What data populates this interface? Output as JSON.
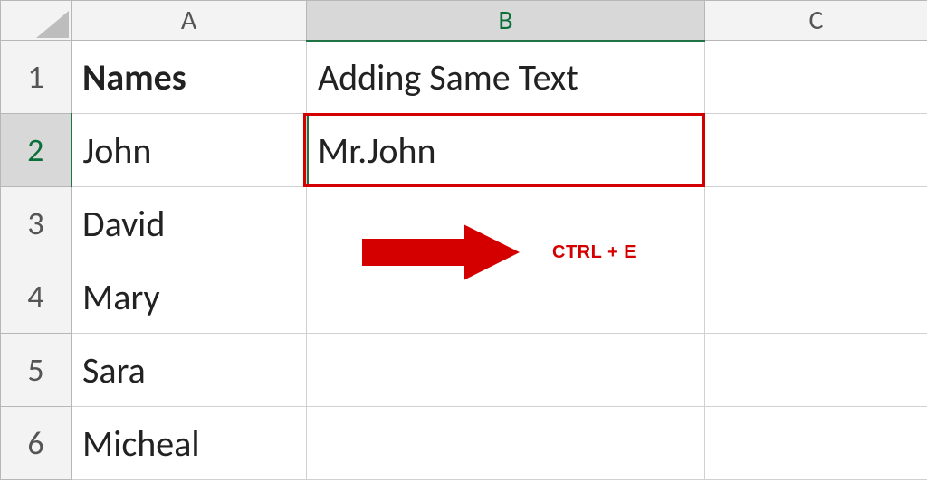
{
  "columns": {
    "a": "A",
    "b": "B",
    "c": "C"
  },
  "rows": {
    "r1": {
      "num": "1",
      "a": "Names",
      "b": "Adding Same Text",
      "c": ""
    },
    "r2": {
      "num": "2",
      "a": "John",
      "b": "Mr.John",
      "c": ""
    },
    "r3": {
      "num": "3",
      "a": "David",
      "b": "",
      "c": ""
    },
    "r4": {
      "num": "4",
      "a": "Mary",
      "b": "",
      "c": ""
    },
    "r5": {
      "num": "5",
      "a": "Sara",
      "b": "",
      "c": ""
    },
    "r6": {
      "num": "6",
      "a": "Micheal",
      "b": "",
      "c": ""
    }
  },
  "annotation": {
    "shortcut": "CTRL + E"
  },
  "colors": {
    "excel_green": "#217346",
    "highlight_red": "#d40000"
  }
}
